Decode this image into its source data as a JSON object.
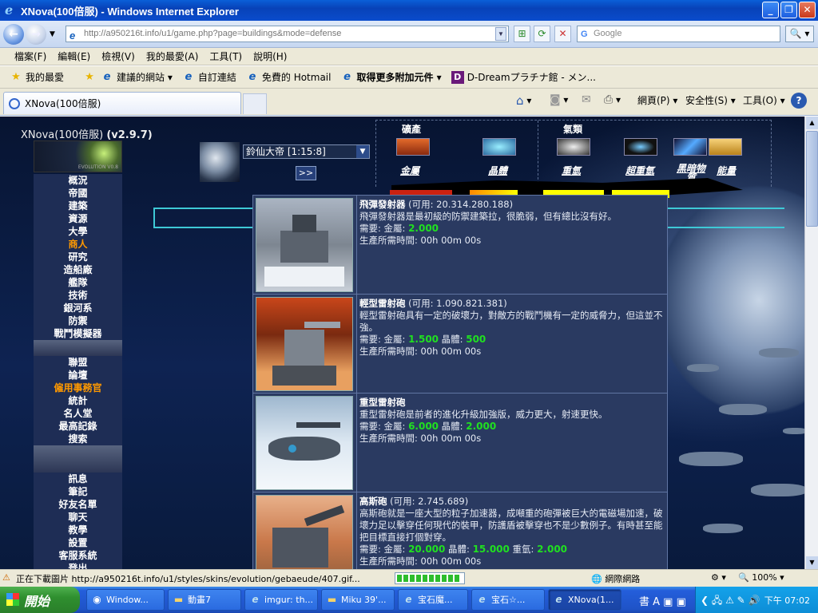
{
  "window": {
    "title": "XNova(100倍服) - Windows Internet Explorer"
  },
  "browser": {
    "url": "http://a950216t.info/u1/game.php?page=buildings&mode=defense",
    "search_placeholder": "Google",
    "menu": [
      "檔案(F)",
      "編輯(E)",
      "檢視(V)",
      "我的最愛(A)",
      "工具(T)",
      "說明(H)"
    ],
    "favorites_label": "我的最愛",
    "favorites": [
      "建議的網站 ▾",
      "自訂連結",
      "免費的 Hotmail",
      "取得更多附加元件 ▾",
      "D-Dreamプラチナ館 - メン..."
    ],
    "tab_title": "XNova(100倍服)",
    "commands": [
      "網頁(P) ▾",
      "安全性(S) ▾",
      "工具(O) ▾"
    ]
  },
  "game": {
    "server_name": "XNova(100倍服)",
    "version": "(v2.9.7)",
    "logo_text": "EVOLUTION V0.8",
    "planet_select": "鈴仙大帝 [1:15:8]",
    "next_button": ">>",
    "nav_group1": [
      "概況",
      "帝國",
      "建築",
      "資源",
      "大學",
      "商人",
      "研究",
      "造船廠",
      "艦隊",
      "技術",
      "銀河系",
      "防禦",
      "戰鬥模擬器"
    ],
    "nav_group2": [
      "聯盟",
      "論壇",
      "僱用事務官",
      "統計",
      "名人堂",
      "最高記錄",
      "搜索"
    ],
    "nav_group3": [
      "訊息",
      "筆記",
      "好友名單",
      "聊天",
      "教學",
      "設置",
      "客服系統",
      "登出"
    ],
    "highlight_color": "#ff9900",
    "resources_header": {
      "mines": "礦產",
      "gas": "氣類"
    },
    "resources": [
      "金屬",
      "晶體",
      "重氫",
      "超重氫",
      "黑暗物質",
      "能量"
    ]
  },
  "defense": [
    {
      "name": "飛彈發射器",
      "avail": " (可用: 20.314.280.188)",
      "desc": "飛彈發射器是最初級的防禦建築拉，很脆弱，但有總比沒有好。",
      "req_prefix": "需要: 金屬: ",
      "metal": "2.000",
      "crystal": "",
      "deut": "",
      "time": "生產所需時間: 00h 00m 00s"
    },
    {
      "name": "輕型雷射砲",
      "avail": " (可用: 1.090.821.381)",
      "desc": "輕型雷射砲具有一定的破壞力，對敵方的戰鬥機有一定的威脅力，但這並不強。",
      "req_prefix": "需要: 金屬: ",
      "metal": "1.500",
      "crystal": "500",
      "deut": "",
      "time": "生產所需時間: 00h 00m 00s"
    },
    {
      "name": "重型雷射砲",
      "avail": "",
      "desc": "重型雷射砲是前者的進化升級加強版，威力更大，射速更快。",
      "req_prefix": "需要: 金屬: ",
      "metal": "6.000",
      "crystal": "2.000",
      "deut": "",
      "time": "生產所需時間: 00h 00m 00s"
    },
    {
      "name": "高斯砲",
      "avail": " (可用: 2.745.689)",
      "desc": "高斯砲就是一座大型的粒子加速器，成噸重的砲彈被巨大的電磁場加速，破壞力足以擊穿任何現代的裝甲，防護盾被擊穿也不是少數例子。有時甚至能把目標直接打個對穿。",
      "req_prefix": "需要: 金屬: ",
      "metal": "20.000",
      "crystal": "15.000",
      "deut": "2.000",
      "time": "生產所需時間: 00h 00m 00s"
    }
  ],
  "labels": {
    "crystal": " 晶體: ",
    "deut": " 重氫: "
  },
  "status": {
    "text": "正在下載圖片 http://a950216t.info/u1/styles/skins/evolution/gebaeude/407.gif...",
    "zone": "網際網路",
    "zoom": "100%",
    "progress": 0.95
  },
  "taskbar": {
    "start": "開始",
    "tasks": [
      "Window...",
      "動畫7",
      "imgur: th...",
      "Miku 39'...",
      "宝石魔...",
      "宝石☆...",
      "XNova(1..."
    ],
    "clock": "下午 07:02"
  }
}
